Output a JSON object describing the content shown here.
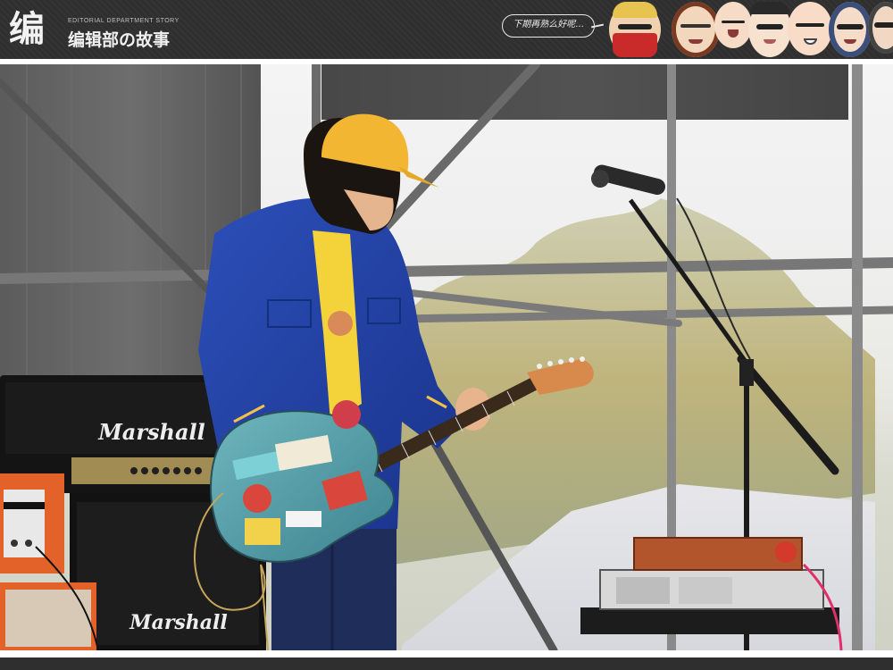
{
  "header": {
    "logo_mark": "编",
    "tagline": "EDITORIAL DEPARTMENT STORY",
    "title": "编辑部の故事",
    "speech_bubble": "下期再熟么好呢..."
  },
  "colors": {
    "header_bg": "#2f2f2f",
    "jacket": "#1f3fa0",
    "cap": "#f2b632",
    "shirt": "#f3d23a",
    "guitar_body": "#4d9aa7",
    "amp_orange": "#e2622a"
  },
  "photo": {
    "amp_brand_top": "Marshall",
    "amp_brand_bottom": "Marshall"
  }
}
